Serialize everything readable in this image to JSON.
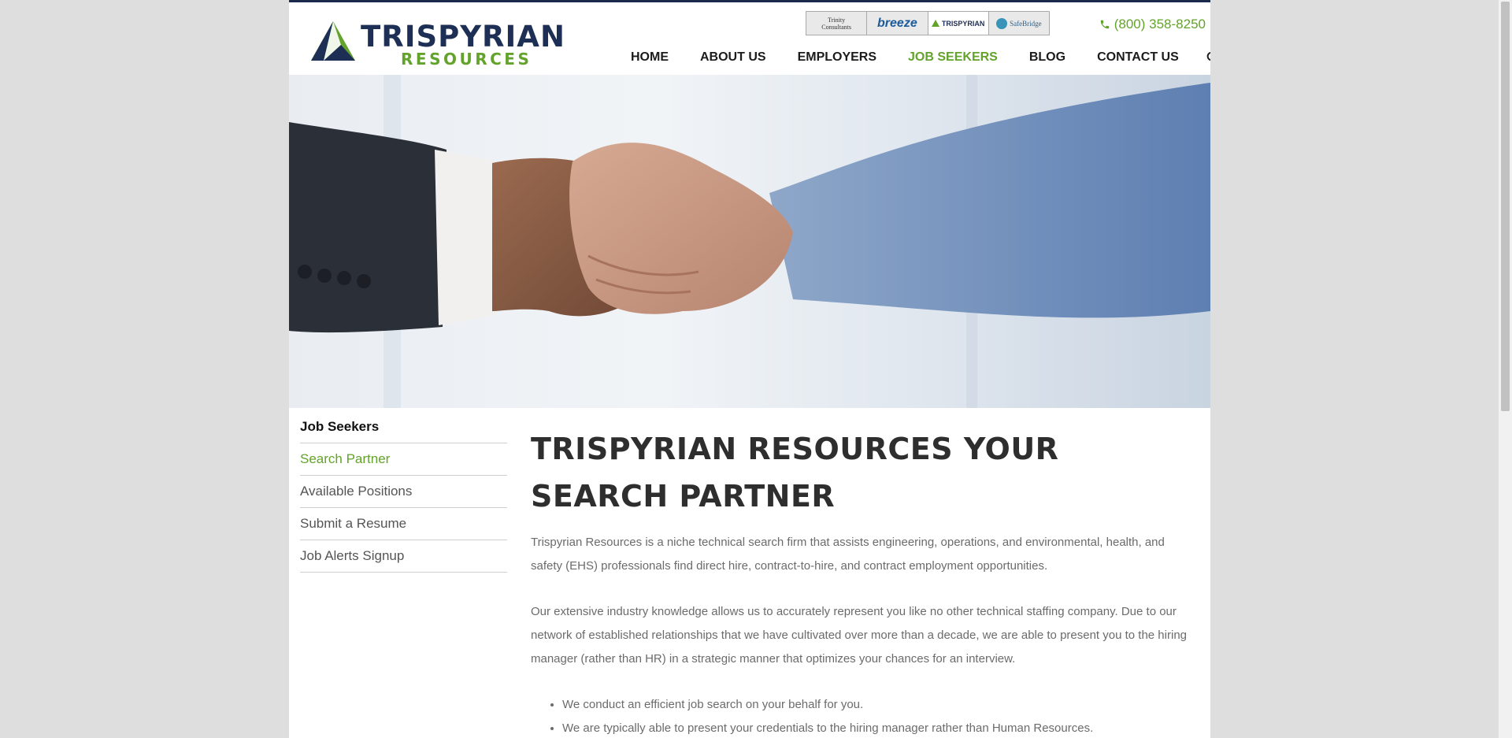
{
  "header": {
    "logo_title": "TRISPYRIAN",
    "logo_subtitle": "RESOURCES",
    "brands": [
      {
        "label": "Trinity Consultants",
        "icon": "trinity-logo"
      },
      {
        "label": "breeze",
        "icon": "breeze-logo"
      },
      {
        "label": "TRISPYRIAN",
        "icon": "trispyrian-logo"
      },
      {
        "label": "SafeBridge",
        "icon": "safebridge-logo"
      }
    ],
    "phone": "(800) 358-8250",
    "phone_icon": "phone-icon",
    "nav": [
      {
        "label": "HOME",
        "active": false
      },
      {
        "label": "ABOUT US",
        "active": false
      },
      {
        "label": "EMPLOYERS",
        "active": false
      },
      {
        "label": "JOB SEEKERS",
        "active": true
      },
      {
        "label": "BLOG",
        "active": false
      },
      {
        "label": "CONTACT US",
        "active": false
      }
    ],
    "search_icon": "search-icon"
  },
  "hero": {
    "image": "handshake-photo"
  },
  "sidebar": {
    "title": "Job Seekers",
    "items": [
      {
        "label": "Search Partner",
        "active": true
      },
      {
        "label": "Available Positions",
        "active": false
      },
      {
        "label": "Submit a Resume",
        "active": false
      },
      {
        "label": "Job Alerts Signup",
        "active": false
      }
    ]
  },
  "main": {
    "heading": "TRISPYRIAN RESOURCES YOUR SEARCH PARTNER",
    "paragraphs": [
      "Trispyrian Resources is a niche technical search firm that assists engineering, operations, and environmental, health, and safety (EHS) professionals find direct hire, contract-to-hire, and contract employment opportunities.",
      "Our extensive industry knowledge allows us to accurately represent you like no other technical staffing company. Due to our network of established relationships that we have cultivated over more than a decade, we are able to present you to the hiring manager (rather than HR) in a strategic manner that optimizes your chances for an interview."
    ],
    "bullets": [
      "We conduct an efficient job search on your behalf for you.",
      "We are typically able to present your credentials to the hiring manager rather than Human Resources."
    ]
  },
  "colors": {
    "brand_navy": "#1d2f55",
    "brand_green": "#63a32b",
    "page_background": "#dedede"
  }
}
